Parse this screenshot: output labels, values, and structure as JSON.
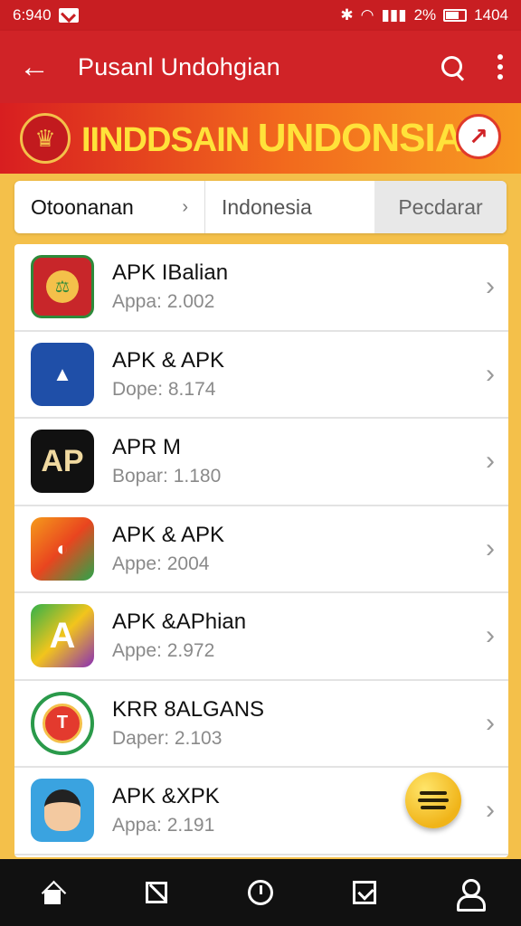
{
  "status": {
    "time": "6:940",
    "battery": "2%",
    "clock": "1404"
  },
  "appbar": {
    "title": "Pusanl Undohgian"
  },
  "banner": {
    "text_a": "IINDDSAIN",
    "text_b": "UNDONSIA"
  },
  "tabs": [
    {
      "label": "Otoonanan",
      "chevron": "›"
    },
    {
      "label": "Indonesia"
    },
    {
      "label": "Pecdarar"
    }
  ],
  "apps": [
    {
      "title": "APK IBalian",
      "sub": "Appa: 2.002",
      "icon": "red-emblem-icon"
    },
    {
      "title": "APK & APK",
      "sub": "Dope: 8.174",
      "icon": "blue-a-icon"
    },
    {
      "title": "APR M",
      "sub": "Bopar: 1.180",
      "icon": "ap-black-icon",
      "glyph": "AP"
    },
    {
      "title": "APK & APK",
      "sub": "Appe: 2004",
      "icon": "orange-swoosh-icon"
    },
    {
      "title": "APK &APhian",
      "sub": "Appe: 2.972",
      "icon": "purple-a-icon",
      "glyph": "A"
    },
    {
      "title": "KRR 8ALGANS",
      "sub": "Daper: 2.103",
      "icon": "badge-icon"
    },
    {
      "title": "APK &XPK",
      "sub": "Appa: 2.191",
      "icon": "avatar-icon"
    }
  ],
  "colors": {
    "primary": "#d02327",
    "accent": "#f4c04a",
    "nav": "#111111"
  }
}
